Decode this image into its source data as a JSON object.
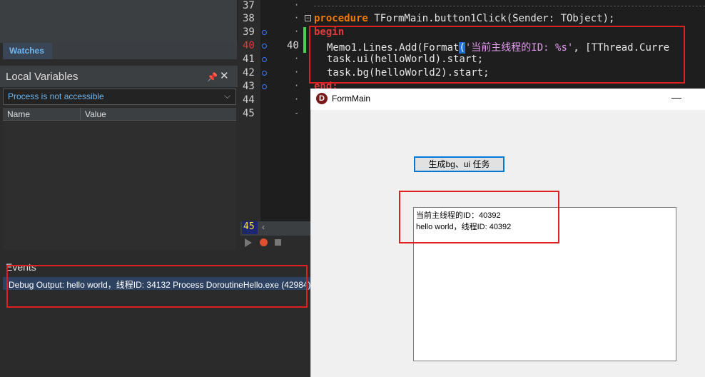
{
  "ide": {
    "watches_tab": "Watches",
    "local_variables": {
      "title": "Local Variables",
      "pin": "📌",
      "close": "✕",
      "select_value": "Process is not accessible",
      "columns": [
        "Name",
        "Value"
      ]
    },
    "events": {
      "title": "Events",
      "line": "Debug Output: hello world，线程ID: 34132 Process DoroutineHello.exe (42984)"
    }
  },
  "editor": {
    "line_numbers": [
      "37",
      "38",
      "39",
      "40",
      "41",
      "42",
      "43",
      "44",
      "45"
    ],
    "exec_line_number": "40",
    "scroll_line": "45",
    "code": {
      "l38_kw": "procedure",
      "l38_rest": " TFormMain.button1Click(Sender: TObject);",
      "l39": "begin",
      "l40_pre": "Memo1.Lines.Add(Format",
      "l40_paren": "(",
      "l40_str": "'当前主线程的ID: %s'",
      "l40_post": ", [TThread.Curre",
      "l41": "task.ui(helloWorld).start;",
      "l42": "task.bg(helloWorld2).start;",
      "l43": "end;"
    }
  },
  "form": {
    "title": "FormMain",
    "minimize": "—",
    "button_label": "生成bg、ui 任务",
    "memo_lines": [
      "当前主线程的ID：40392",
      "hello world，线程ID: 40392"
    ]
  }
}
